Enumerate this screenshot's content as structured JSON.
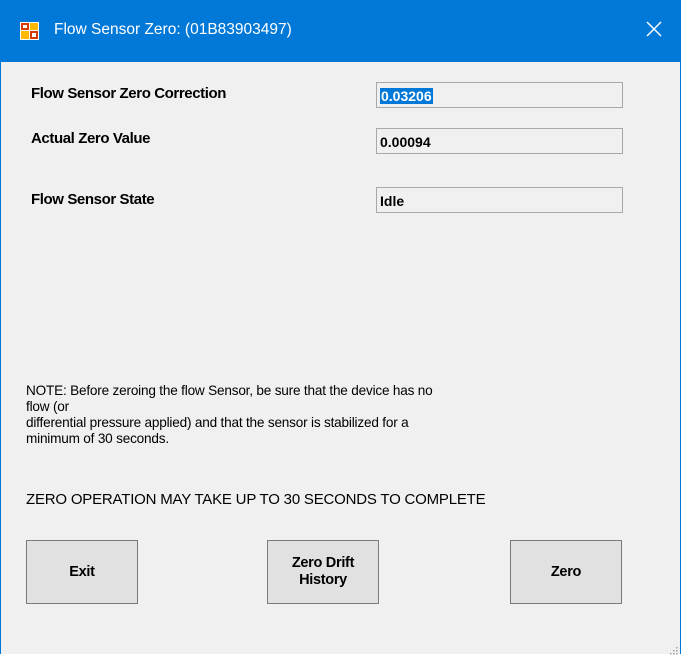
{
  "window": {
    "title": "Flow Sensor Zero: (01B83903497)",
    "accent_color": "#0078d7",
    "icons": {
      "app": "app-icon",
      "close": "close-icon",
      "grip": "resize-grip-icon"
    }
  },
  "fields": {
    "zero_correction": {
      "label": "Flow Sensor Zero Correction",
      "value": "0.03206"
    },
    "actual_zero": {
      "label": "Actual Zero Value",
      "value": "0.00094"
    },
    "sensor_state": {
      "label": "Flow Sensor State",
      "value": "Idle"
    }
  },
  "note": {
    "line1": "NOTE: Before zeroing the flow Sensor, be sure that the device has no flow (or",
    "line2": "differential pressure applied) and that the sensor is stabilized for a",
    "line3": "minimum of 30 seconds."
  },
  "warning": "ZERO OPERATION MAY TAKE UP TO 30 SECONDS TO COMPLETE",
  "buttons": {
    "exit": "Exit",
    "zero_drift_line1": "Zero Drift",
    "zero_drift_line2": "History",
    "zero": "Zero"
  }
}
